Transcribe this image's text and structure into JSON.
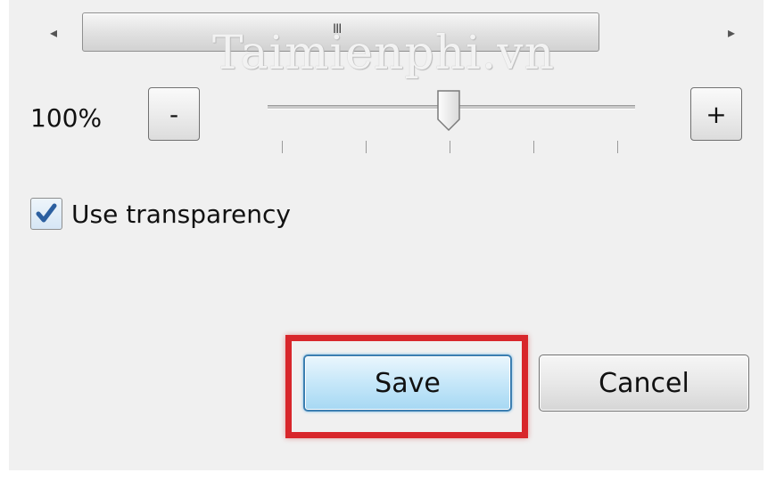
{
  "scrollbar": {
    "left_arrow_icon": "triangle-left-icon",
    "right_arrow_icon": "triangle-right-icon",
    "thumb_grip": "III"
  },
  "watermark": "Taimienphi.vn",
  "zoom": {
    "label": "100%",
    "minus_label": "-",
    "plus_label": "+",
    "value_percent": 100,
    "slider_position_fraction": 0.5,
    "tick_count": 5
  },
  "transparency": {
    "label": "Use transparency",
    "checked": true
  },
  "actions": {
    "save_label": "Save",
    "cancel_label": "Cancel"
  },
  "colors": {
    "highlight": "#d8262b",
    "save_button_border": "#3c7fb1",
    "checkmark": "#2b5fa0"
  }
}
